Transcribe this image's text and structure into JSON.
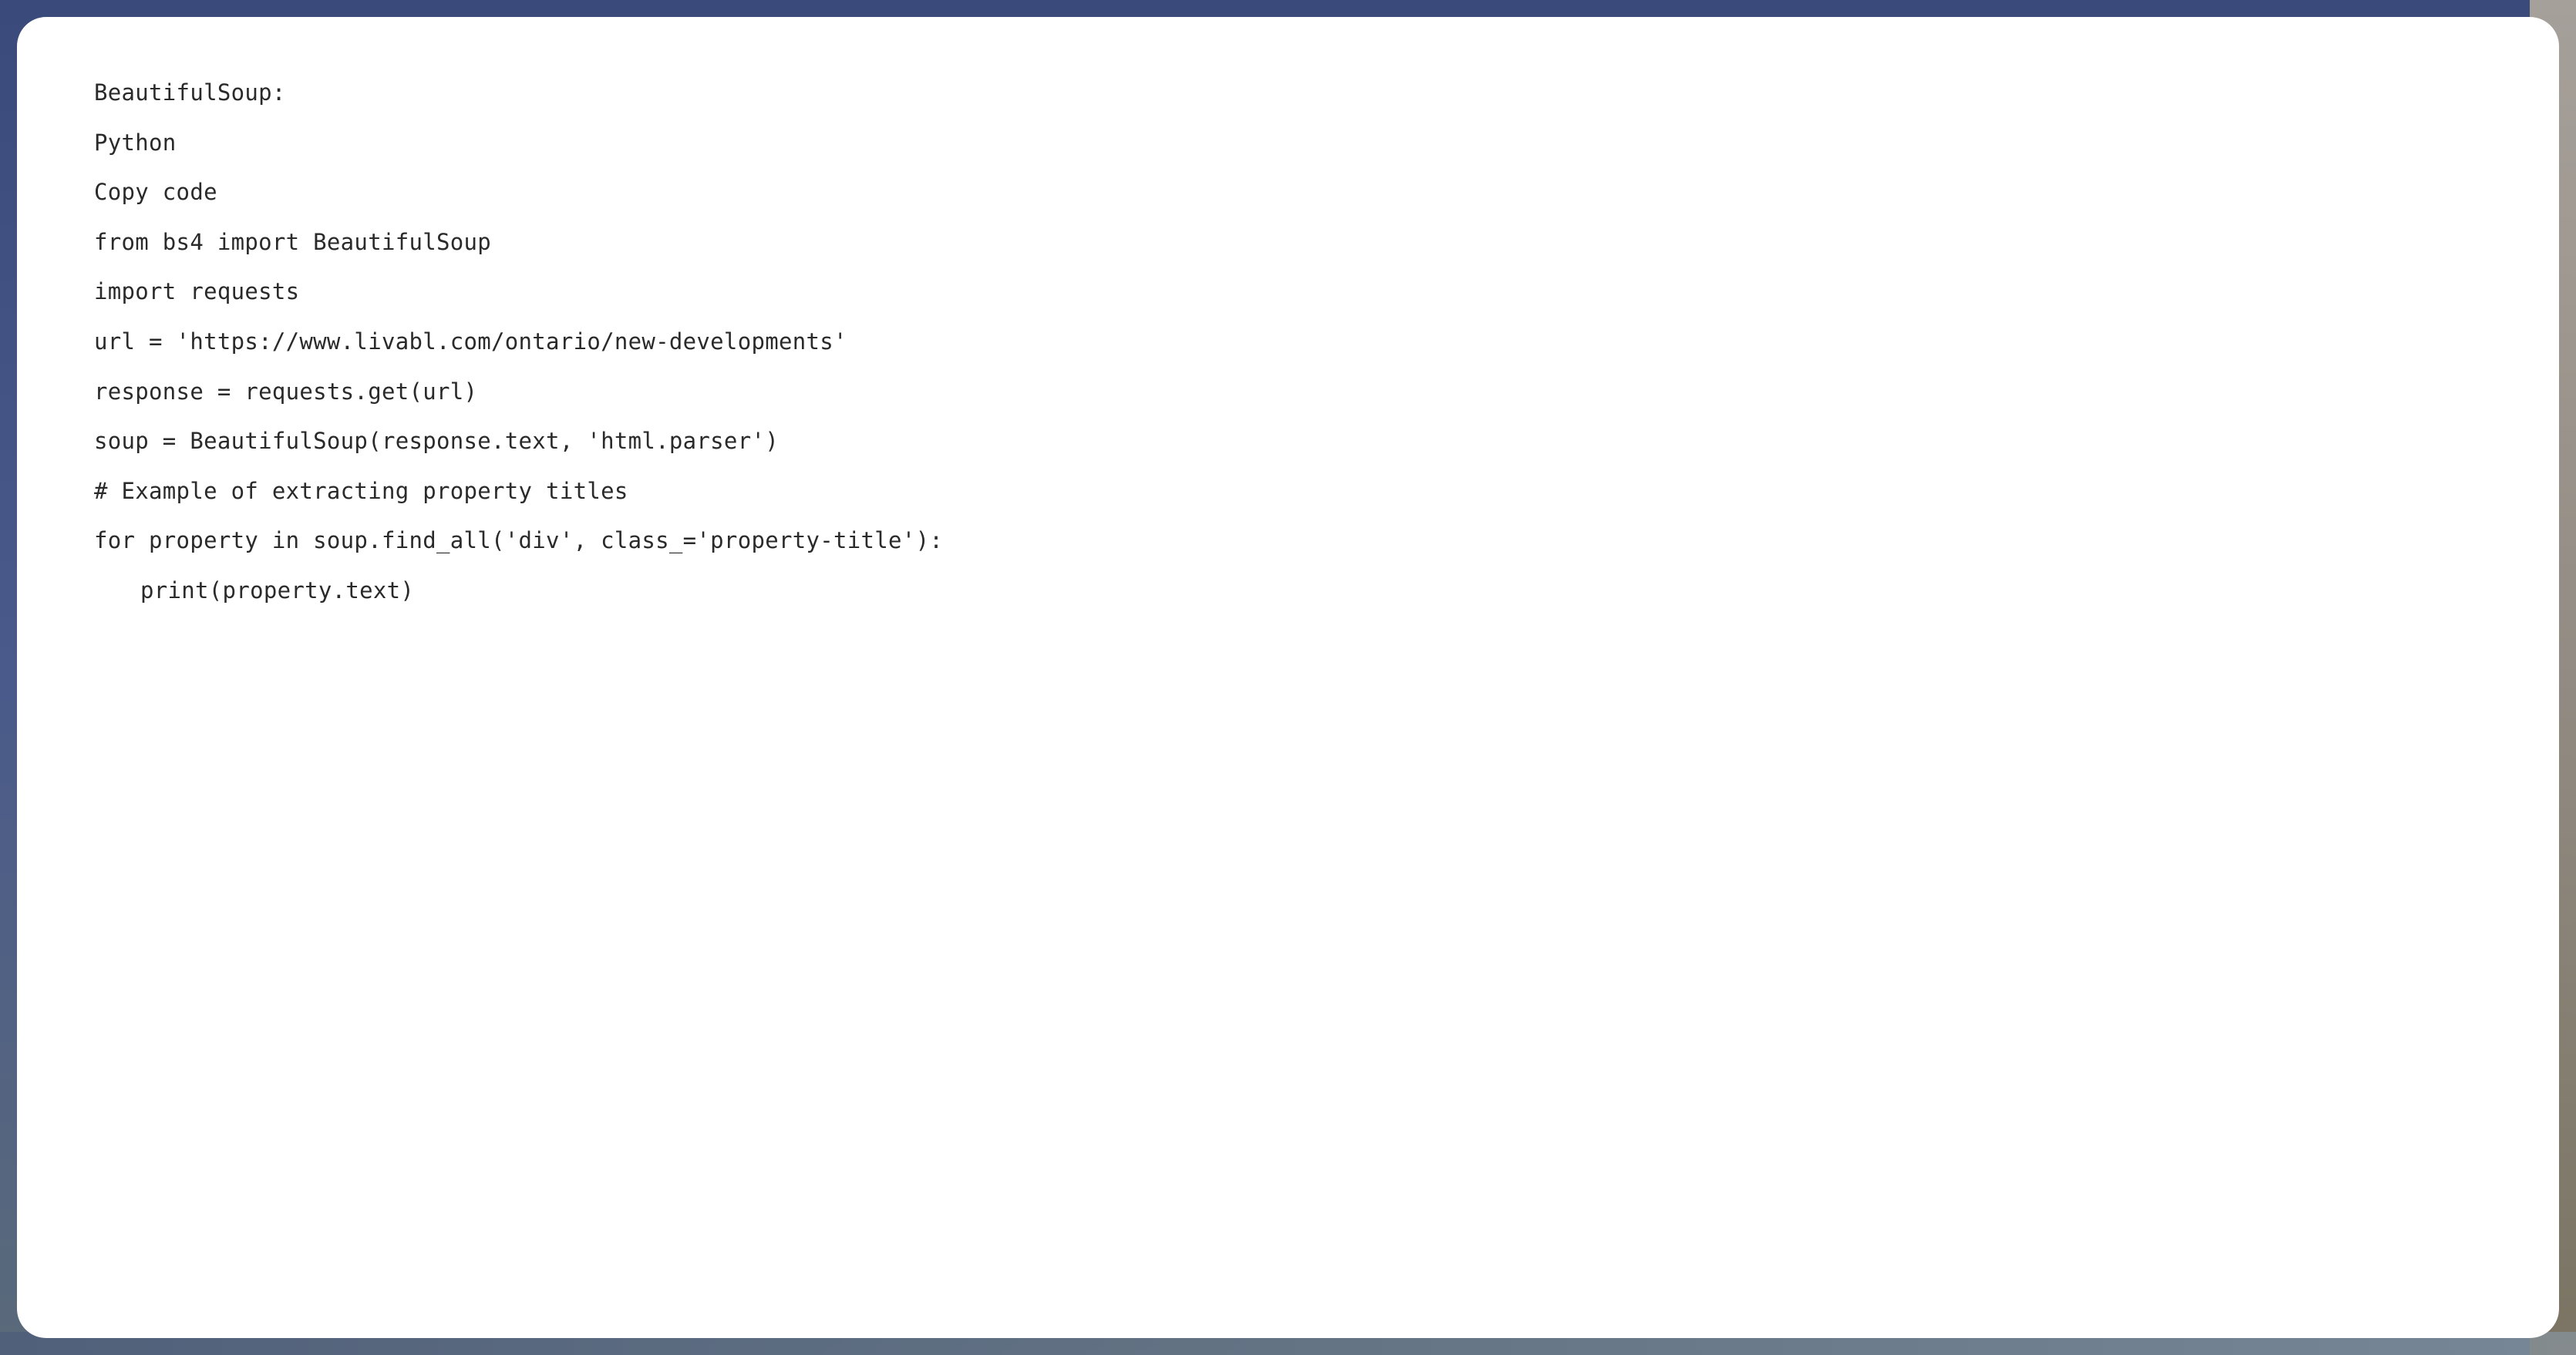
{
  "code": {
    "lines": [
      {
        "text": "BeautifulSoup:",
        "indent": false
      },
      {
        "text": "Python",
        "indent": false
      },
      {
        "text": "Copy code",
        "indent": false
      },
      {
        "text": "from bs4 import BeautifulSoup",
        "indent": false
      },
      {
        "text": "import requests",
        "indent": false
      },
      {
        "text": "url = 'https://www.livabl.com/ontario/new-developments'",
        "indent": false
      },
      {
        "text": "response = requests.get(url)",
        "indent": false
      },
      {
        "text": "soup = BeautifulSoup(response.text, 'html.parser')",
        "indent": false
      },
      {
        "text": "# Example of extracting property titles",
        "indent": false
      },
      {
        "text": "for property in soup.find_all('div', class_='property-title'):",
        "indent": false
      },
      {
        "text": "print(property.text)",
        "indent": true
      }
    ]
  }
}
